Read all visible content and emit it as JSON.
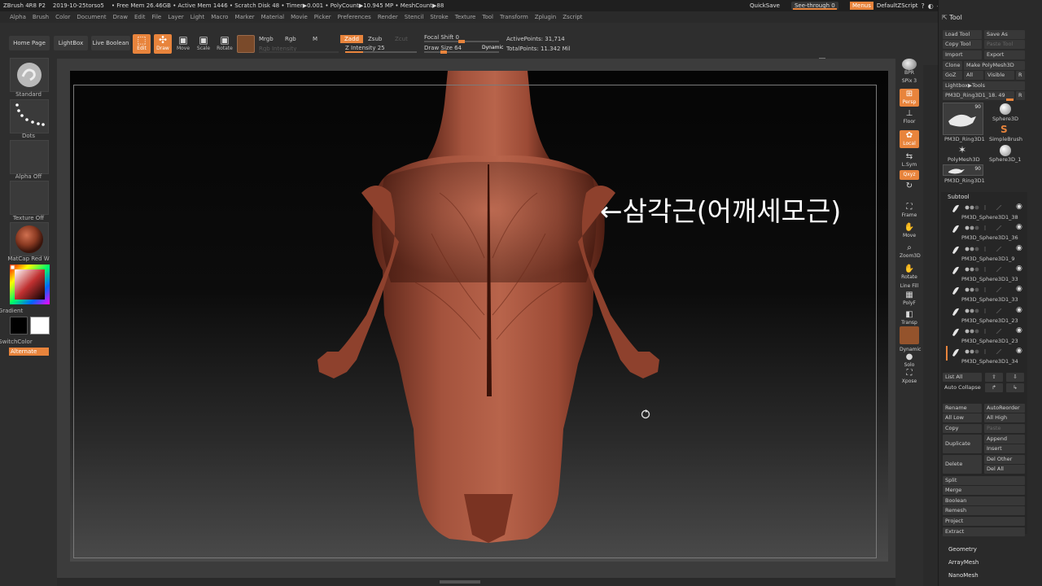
{
  "titlebar": {
    "app": "ZBrush 4R8 P2",
    "file": "2019-10-25torso5",
    "stats": "• Free Mem 26.46GB • Active Mem 1446 • Scratch Disk 48 •  Timer▶0.001 • PolyCount▶10.945 MP • MeshCount▶88",
    "quicksave": "QuickSave",
    "see_through": "See-through  0",
    "menus": "Menus",
    "default_script": "DefaultZScript"
  },
  "menubar": [
    "Alpha",
    "Brush",
    "Color",
    "Document",
    "Draw",
    "Edit",
    "File",
    "Layer",
    "Light",
    "Macro",
    "Marker",
    "Material",
    "Movie",
    "Picker",
    "Preferences",
    "Render",
    "Stencil",
    "Stroke",
    "Texture",
    "Tool",
    "Transform",
    "Zplugin",
    "Zscript"
  ],
  "toolbar": {
    "home_page": "Home Page",
    "lightbox": "LightBox",
    "live_boolean": "Live Boolean",
    "edit": "Edit",
    "draw": "Draw",
    "move": "Move",
    "scale": "Scale",
    "rotate": "Rotate",
    "mrgb": "Mrgb",
    "rgb": "Rgb",
    "m": "M",
    "rgb_intensity": "Rgb Intensity",
    "zadd": "Zadd",
    "zsub": "Zsub",
    "zcut": "Zcut",
    "z_intensity": "Z Intensity 25",
    "focal_shift": "Focal Shift 0",
    "draw_size": "Draw Size 64",
    "dynamic": "Dynamic",
    "active_points": "ActivePoints: 31,714",
    "total_points": "TotalPoints: 11.342 Mil"
  },
  "leftshelf": {
    "brush": "Standard",
    "stroke": "Dots",
    "alpha": "Alpha Off",
    "texture": "Texture Off",
    "material": "MatCap Red W",
    "gradient": "Gradient",
    "switchcolor": "SwitchColor",
    "alternate": "Alternate"
  },
  "annotation": "←삼각근(어깨세모근)",
  "rightshelf": {
    "bpr": "BPR",
    "spix": "SPix 3",
    "persp": "Persp",
    "floor": "Floor",
    "local": "Local",
    "lsym": "L.Sym",
    "xyz": "Qxyz",
    "frame": "Frame",
    "move": "Move",
    "zoom3d": "Zoom3D",
    "rotate": "Rotate",
    "linefill": "Line Fill",
    "polyf": "PolyF",
    "transp": "Transp",
    "solo": "Solo",
    "dynamic": "Dynamic",
    "xpose": "Xpose"
  },
  "tool_panel": {
    "title": "Tool",
    "load_tool": "Load Tool",
    "save_as": "Save As",
    "copy_tool": "Copy Tool",
    "paste_tool": "Paste Tool",
    "import": "Import",
    "export": "Export",
    "clone": "Clone",
    "make_polymesh": "Make PolyMesh3D",
    "goz": "GoZ",
    "all": "All",
    "visible": "Visible",
    "r": "R",
    "lightbox_tools": "Lightbox▶Tools",
    "current_tool": "PM3D_Ring3D1_18. 49",
    "thumb_count_1": "90",
    "thumb_name_1": "PM3D_Ring3D1",
    "sphere3d": "Sphere3D",
    "simplebrush": "SimpleBrush",
    "polymesh3d": "PolyMesh3D",
    "sphere3d_1": "Sphere3D_1",
    "thumb_count_2": "90",
    "thumb_name_2": "PM3D_Ring3D1"
  },
  "subtool": {
    "title": "Subtool",
    "items": [
      "PM3D_Sphere3D1_38",
      "PM3D_Sphere3D1_36",
      "PM3D_Sphere3D1_9",
      "PM3D_Sphere3D1_33",
      "PM3D_Sphere3D1_33",
      "PM3D_Sphere3D1_23",
      "PM3D_Sphere3D1_23",
      "PM3D_Sphere3D1_34"
    ],
    "list_all": "List All",
    "auto_collapse": "Auto Collapse",
    "rename": "Rename",
    "auto_reorder": "AutoReorder",
    "all_low": "All Low",
    "all_high": "All High",
    "copy": "Copy",
    "paste": "Paste",
    "duplicate": "Duplicate",
    "append": "Append",
    "insert": "Insert",
    "delete": "Delete",
    "del_other": "Del Other",
    "del_all": "Del All",
    "split": "Split",
    "merge": "Merge",
    "boolean": "Boolean",
    "remesh": "Remesh",
    "project": "Project",
    "extract": "Extract"
  },
  "bottom_menus": [
    "Geometry",
    "ArrayMesh",
    "NanoMesh"
  ]
}
